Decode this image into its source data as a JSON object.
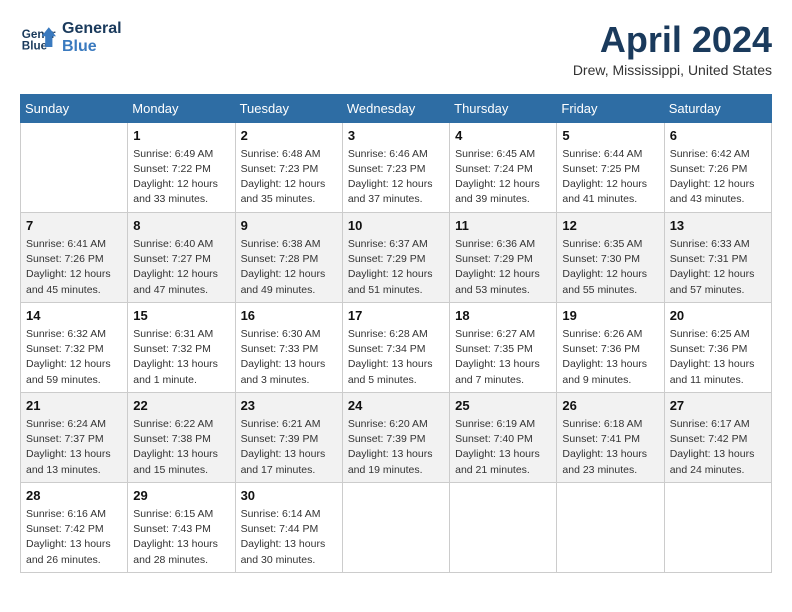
{
  "header": {
    "logo_line1": "General",
    "logo_line2": "Blue",
    "month_title": "April 2024",
    "location": "Drew, Mississippi, United States"
  },
  "weekdays": [
    "Sunday",
    "Monday",
    "Tuesday",
    "Wednesday",
    "Thursday",
    "Friday",
    "Saturday"
  ],
  "weeks": [
    [
      {
        "day": "",
        "info": ""
      },
      {
        "day": "1",
        "info": "Sunrise: 6:49 AM\nSunset: 7:22 PM\nDaylight: 12 hours\nand 33 minutes."
      },
      {
        "day": "2",
        "info": "Sunrise: 6:48 AM\nSunset: 7:23 PM\nDaylight: 12 hours\nand 35 minutes."
      },
      {
        "day": "3",
        "info": "Sunrise: 6:46 AM\nSunset: 7:23 PM\nDaylight: 12 hours\nand 37 minutes."
      },
      {
        "day": "4",
        "info": "Sunrise: 6:45 AM\nSunset: 7:24 PM\nDaylight: 12 hours\nand 39 minutes."
      },
      {
        "day": "5",
        "info": "Sunrise: 6:44 AM\nSunset: 7:25 PM\nDaylight: 12 hours\nand 41 minutes."
      },
      {
        "day": "6",
        "info": "Sunrise: 6:42 AM\nSunset: 7:26 PM\nDaylight: 12 hours\nand 43 minutes."
      }
    ],
    [
      {
        "day": "7",
        "info": "Sunrise: 6:41 AM\nSunset: 7:26 PM\nDaylight: 12 hours\nand 45 minutes."
      },
      {
        "day": "8",
        "info": "Sunrise: 6:40 AM\nSunset: 7:27 PM\nDaylight: 12 hours\nand 47 minutes."
      },
      {
        "day": "9",
        "info": "Sunrise: 6:38 AM\nSunset: 7:28 PM\nDaylight: 12 hours\nand 49 minutes."
      },
      {
        "day": "10",
        "info": "Sunrise: 6:37 AM\nSunset: 7:29 PM\nDaylight: 12 hours\nand 51 minutes."
      },
      {
        "day": "11",
        "info": "Sunrise: 6:36 AM\nSunset: 7:29 PM\nDaylight: 12 hours\nand 53 minutes."
      },
      {
        "day": "12",
        "info": "Sunrise: 6:35 AM\nSunset: 7:30 PM\nDaylight: 12 hours\nand 55 minutes."
      },
      {
        "day": "13",
        "info": "Sunrise: 6:33 AM\nSunset: 7:31 PM\nDaylight: 12 hours\nand 57 minutes."
      }
    ],
    [
      {
        "day": "14",
        "info": "Sunrise: 6:32 AM\nSunset: 7:32 PM\nDaylight: 12 hours\nand 59 minutes."
      },
      {
        "day": "15",
        "info": "Sunrise: 6:31 AM\nSunset: 7:32 PM\nDaylight: 13 hours\nand 1 minute."
      },
      {
        "day": "16",
        "info": "Sunrise: 6:30 AM\nSunset: 7:33 PM\nDaylight: 13 hours\nand 3 minutes."
      },
      {
        "day": "17",
        "info": "Sunrise: 6:28 AM\nSunset: 7:34 PM\nDaylight: 13 hours\nand 5 minutes."
      },
      {
        "day": "18",
        "info": "Sunrise: 6:27 AM\nSunset: 7:35 PM\nDaylight: 13 hours\nand 7 minutes."
      },
      {
        "day": "19",
        "info": "Sunrise: 6:26 AM\nSunset: 7:36 PM\nDaylight: 13 hours\nand 9 minutes."
      },
      {
        "day": "20",
        "info": "Sunrise: 6:25 AM\nSunset: 7:36 PM\nDaylight: 13 hours\nand 11 minutes."
      }
    ],
    [
      {
        "day": "21",
        "info": "Sunrise: 6:24 AM\nSunset: 7:37 PM\nDaylight: 13 hours\nand 13 minutes."
      },
      {
        "day": "22",
        "info": "Sunrise: 6:22 AM\nSunset: 7:38 PM\nDaylight: 13 hours\nand 15 minutes."
      },
      {
        "day": "23",
        "info": "Sunrise: 6:21 AM\nSunset: 7:39 PM\nDaylight: 13 hours\nand 17 minutes."
      },
      {
        "day": "24",
        "info": "Sunrise: 6:20 AM\nSunset: 7:39 PM\nDaylight: 13 hours\nand 19 minutes."
      },
      {
        "day": "25",
        "info": "Sunrise: 6:19 AM\nSunset: 7:40 PM\nDaylight: 13 hours\nand 21 minutes."
      },
      {
        "day": "26",
        "info": "Sunrise: 6:18 AM\nSunset: 7:41 PM\nDaylight: 13 hours\nand 23 minutes."
      },
      {
        "day": "27",
        "info": "Sunrise: 6:17 AM\nSunset: 7:42 PM\nDaylight: 13 hours\nand 24 minutes."
      }
    ],
    [
      {
        "day": "28",
        "info": "Sunrise: 6:16 AM\nSunset: 7:42 PM\nDaylight: 13 hours\nand 26 minutes."
      },
      {
        "day": "29",
        "info": "Sunrise: 6:15 AM\nSunset: 7:43 PM\nDaylight: 13 hours\nand 28 minutes."
      },
      {
        "day": "30",
        "info": "Sunrise: 6:14 AM\nSunset: 7:44 PM\nDaylight: 13 hours\nand 30 minutes."
      },
      {
        "day": "",
        "info": ""
      },
      {
        "day": "",
        "info": ""
      },
      {
        "day": "",
        "info": ""
      },
      {
        "day": "",
        "info": ""
      }
    ]
  ]
}
